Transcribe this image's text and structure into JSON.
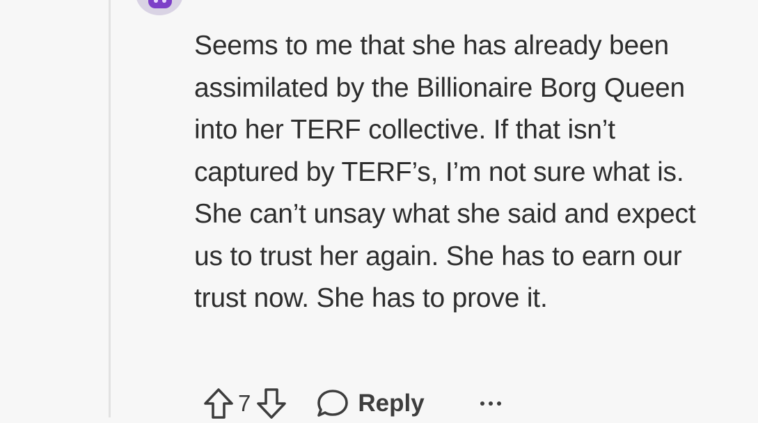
{
  "comment": {
    "body": "Seems to me that she has already been assimilated by the Billionaire Borg Queen into her TERF collective. If that isn’t captured by TERF’s, I’m not sure what is. She can’t unsay what she said and expect us to trust her again. She has to earn our trust now. She has to prove it."
  },
  "actions": {
    "vote_count": "7",
    "reply_label": "Reply",
    "upvote_icon": "arrow-up-outline",
    "downvote_icon": "arrow-down-outline",
    "reply_icon": "speech-bubble-outline",
    "more_icon": "horizontal-ellipsis"
  },
  "colors": {
    "background": "#f7f7f7",
    "text": "#2d2d2d",
    "avatar_accent": "#7d3fc8"
  }
}
